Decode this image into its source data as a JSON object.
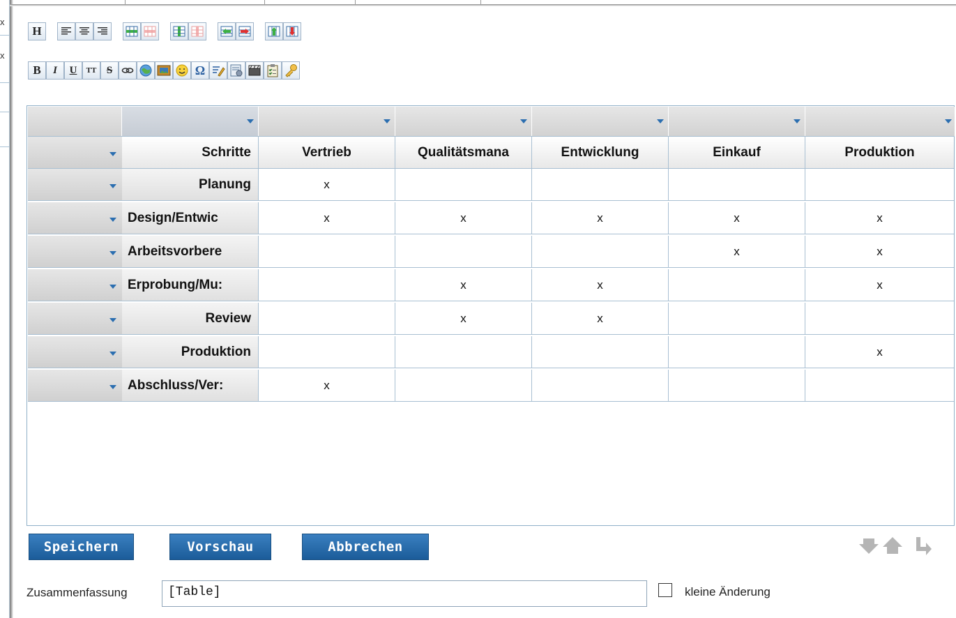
{
  "background": {
    "left_marks": [
      "x",
      "x"
    ]
  },
  "toolbar": {
    "row1": [
      "heading-icon",
      "align-left-icon",
      "align-center-icon",
      "align-right-icon",
      "insert-row-icon",
      "delete-row-icon",
      "insert-column-icon",
      "delete-column-icon",
      "move-row-left-icon",
      "move-row-right-icon",
      "move-up-icon",
      "move-down-icon"
    ],
    "row2": {
      "bold": "B",
      "italic": "I",
      "underline": "U",
      "teletype": "TT",
      "strike": "S"
    }
  },
  "table": {
    "header": [
      "Schritte",
      "Vertrieb",
      "Qualitätsmana",
      "Entwicklung",
      "Einkauf",
      "Produktion"
    ],
    "rows": [
      {
        "step": "Planung",
        "cells": [
          "x",
          "",
          "",
          "",
          ""
        ]
      },
      {
        "step": "Design/Entwic",
        "cells": [
          "x",
          "x",
          "x",
          "x",
          "x"
        ]
      },
      {
        "step": "Arbeitsvorbere",
        "cells": [
          "",
          "",
          "",
          "x",
          "x"
        ]
      },
      {
        "step": "Erprobung/Mu:",
        "cells": [
          "",
          "x",
          "x",
          "",
          "x"
        ]
      },
      {
        "step": "Review",
        "cells": [
          "",
          "x",
          "x",
          "",
          ""
        ]
      },
      {
        "step": "Produktion",
        "cells": [
          "",
          "",
          "",
          "",
          "x"
        ]
      },
      {
        "step": "Abschluss/Ver:",
        "cells": [
          "x",
          "",
          "",
          "",
          ""
        ]
      }
    ]
  },
  "actions": {
    "save": "Speichern",
    "preview": "Vorschau",
    "cancel": "Abbrechen"
  },
  "summary": {
    "label": "Zusammenfassung",
    "value": "[Table]",
    "minor_label": "kleine Änderung"
  },
  "colors": {
    "accent": "#2b6eb0",
    "button": "#1b5c99",
    "border": "#a8bfd2"
  }
}
